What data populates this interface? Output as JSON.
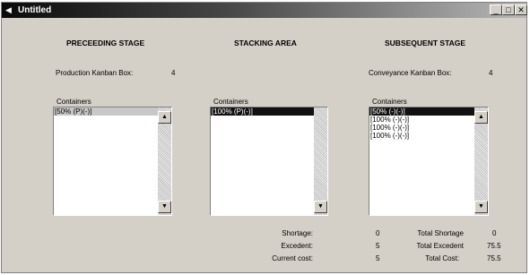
{
  "window": {
    "title": "Untitled",
    "minimize": "_",
    "maximize": "□",
    "close": "✕"
  },
  "stages": {
    "preceding": {
      "title": "PRECEEDING STAGE",
      "kanban_label": "Production Kanban Box:",
      "kanban_value": "4",
      "containers_label": "Containers",
      "containers": [
        "[50% (P)(-)]"
      ]
    },
    "stacking": {
      "title": "STACKING AREA",
      "containers_label": "Containers",
      "containers": [
        "[100% (P)(-)]"
      ]
    },
    "subsequent": {
      "title": "SUBSEQUENT STAGE",
      "kanban_label": "Conveyance Kanban Box:",
      "kanban_value": "4",
      "containers_label": "Containers",
      "containers": [
        "[50% (-)(-)]",
        "[100% (-)(-)]",
        "[100% (-)(-)]",
        "[100% (-)(-)]"
      ]
    }
  },
  "stats": {
    "shortage_label": "Shortage:",
    "shortage_value": "0",
    "excedent_label": "Excedent:",
    "excedent_value": "5",
    "current_cost_label": "Current cost:",
    "current_cost_value": "5",
    "total_shortage_label": "Total Shortage",
    "total_shortage_value": "0",
    "total_excedent_label": "Total Excedent",
    "total_excedent_value": "75.5",
    "total_cost_label": "Total Cost:",
    "total_cost_value": "75.5"
  },
  "icons": {
    "app": "◀",
    "scroll_up": "▲",
    "scroll_down": "▼"
  }
}
